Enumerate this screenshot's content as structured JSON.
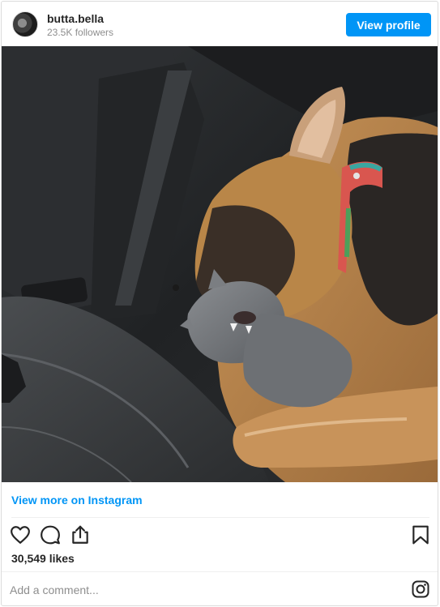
{
  "header": {
    "username": "butta.bella",
    "followers": "23.5K followers",
    "view_profile_label": "View profile"
  },
  "post": {
    "photo_subject": "German shepherd puppy sleeping with a gray cat in a car back seat",
    "view_more_label": "View more on Instagram",
    "likes": "30,549 likes"
  },
  "comment": {
    "placeholder": "Add a comment..."
  },
  "icons": {
    "like": "heart-icon",
    "comment": "comment-icon",
    "share": "share-icon",
    "save": "bookmark-icon",
    "brand": "instagram-icon"
  },
  "colors": {
    "accent": "#0095f6",
    "text": "#262626",
    "muted": "#8e8e8e",
    "border": "#dbdbdb"
  }
}
